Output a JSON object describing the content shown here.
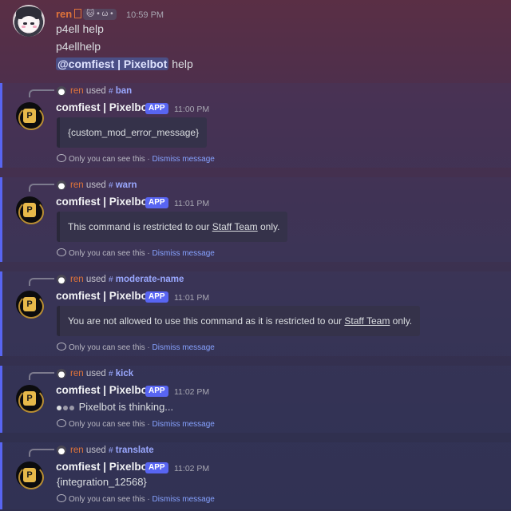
{
  "top_message": {
    "username": "ren",
    "tag": "• ω •",
    "time": "10:59 PM",
    "lines": [
      "p4ell help",
      "p4ellhelp"
    ],
    "mention": "@comfiest | Pixelbot",
    "mention_suffix": "help"
  },
  "common": {
    "user": "ren",
    "used": "used",
    "bot_name": "comfiest | Pixelbot",
    "app_tag": "APP",
    "only_you": "Only you can see this",
    "separator": "·",
    "dismiss": "Dismiss message",
    "bot_initial": "P"
  },
  "blocks": [
    {
      "command": "ban",
      "time": "11:00 PM",
      "embed": "{custom_mod_error_message}"
    },
    {
      "command": "warn",
      "time": "11:01 PM",
      "embed_pre": "This command is restricted to our ",
      "embed_link": "Staff Team",
      "embed_post": " only."
    },
    {
      "command": "moderate-name",
      "time": "11:01 PM",
      "embed_pre": "You are not allowed to use this command as it is restricted to our ",
      "embed_link": "Staff Team",
      "embed_post": " only."
    },
    {
      "command": "kick",
      "time": "11:02 PM",
      "text": "Pixelbot is thinking..."
    },
    {
      "command": "translate",
      "time": "11:02 PM",
      "text": "{integration_12568}"
    }
  ]
}
